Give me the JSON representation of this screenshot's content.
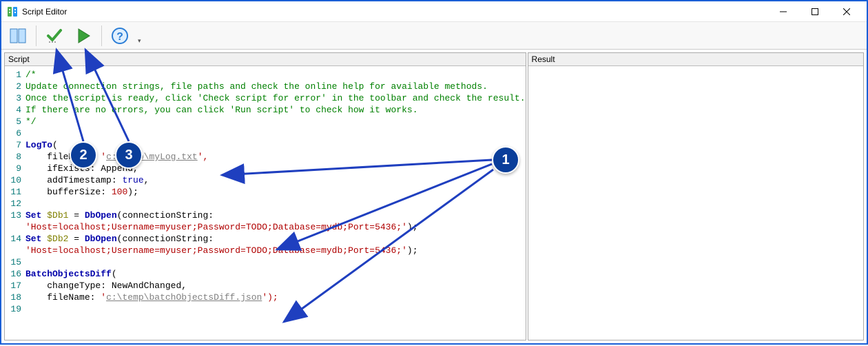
{
  "window": {
    "title": "Script Editor"
  },
  "toolbar": {
    "btn_split": "Split panels",
    "btn_check": "Check script for error",
    "btn_run": "Run script",
    "btn_help": "Help"
  },
  "panels": {
    "script_title": "Script",
    "result_title": "Result"
  },
  "code": {
    "lines": [
      {
        "n": "1",
        "raw": "/*",
        "cls": "tok-comment"
      },
      {
        "n": "2",
        "raw": "Update connection strings, file paths and check the online help for available methods.",
        "cls": "tok-comment"
      },
      {
        "n": "3",
        "raw": "Once the script is ready, click 'Check script for error' in the toolbar and check the result.",
        "cls": "tok-comment"
      },
      {
        "n": "4",
        "raw": "If there are no errors, you can click 'Run script' to check how it works.",
        "cls": "tok-comment"
      },
      {
        "n": "5",
        "raw": "*/",
        "cls": "tok-comment"
      },
      {
        "n": "6",
        "raw": ""
      },
      {
        "n": "7",
        "fn": "LogTo",
        "rest": "("
      },
      {
        "n": "8",
        "indent": "    ",
        "key": "fileName:",
        "str": "'",
        "ul": "c:\\temp\\myLog.txt",
        "strend": "',"
      },
      {
        "n": "9",
        "indent": "    ",
        "key": "ifExists:",
        "val": " Append,"
      },
      {
        "n": "10",
        "indent": "    ",
        "key": "addTimestamp:",
        "bool": " true",
        "after": ","
      },
      {
        "n": "11",
        "indent": "    ",
        "key": "bufferSize:",
        "num": " 100",
        "after": ");"
      },
      {
        "n": "12",
        "raw": ""
      },
      {
        "n": "13",
        "set": "Set",
        "var": "$Db1",
        "eq": " = ",
        "fn": "DbOpen",
        "rest2": "(connectionString:",
        "cont": "'Host=localhost;Username=myuser;Password=TODO;Database=mydb;Port=5436;'",
        "after2": ");"
      },
      {
        "n": "14",
        "set": "Set",
        "var": "$Db2",
        "eq": " = ",
        "fn": "DbOpen",
        "rest2": "(connectionString:",
        "cont": "'Host=localhost;Username=myuser;Password=TODO;Database=mydb;Port=5436;'",
        "after2": ");"
      },
      {
        "n": "15",
        "raw": ""
      },
      {
        "n": "16",
        "fn": "BatchObjectsDiff",
        "rest": "("
      },
      {
        "n": "17",
        "indent": "    ",
        "key": "changeType:",
        "val": " NewAndChanged,"
      },
      {
        "n": "18",
        "indent": "    ",
        "key": "fileName:",
        "str": "'",
        "ul": "c:\\temp\\batchObjectsDiff.json",
        "strend": "');"
      },
      {
        "n": "19",
        "raw": ""
      }
    ]
  },
  "annotations": {
    "callout1": "1",
    "callout2": "2",
    "callout3": "3"
  }
}
